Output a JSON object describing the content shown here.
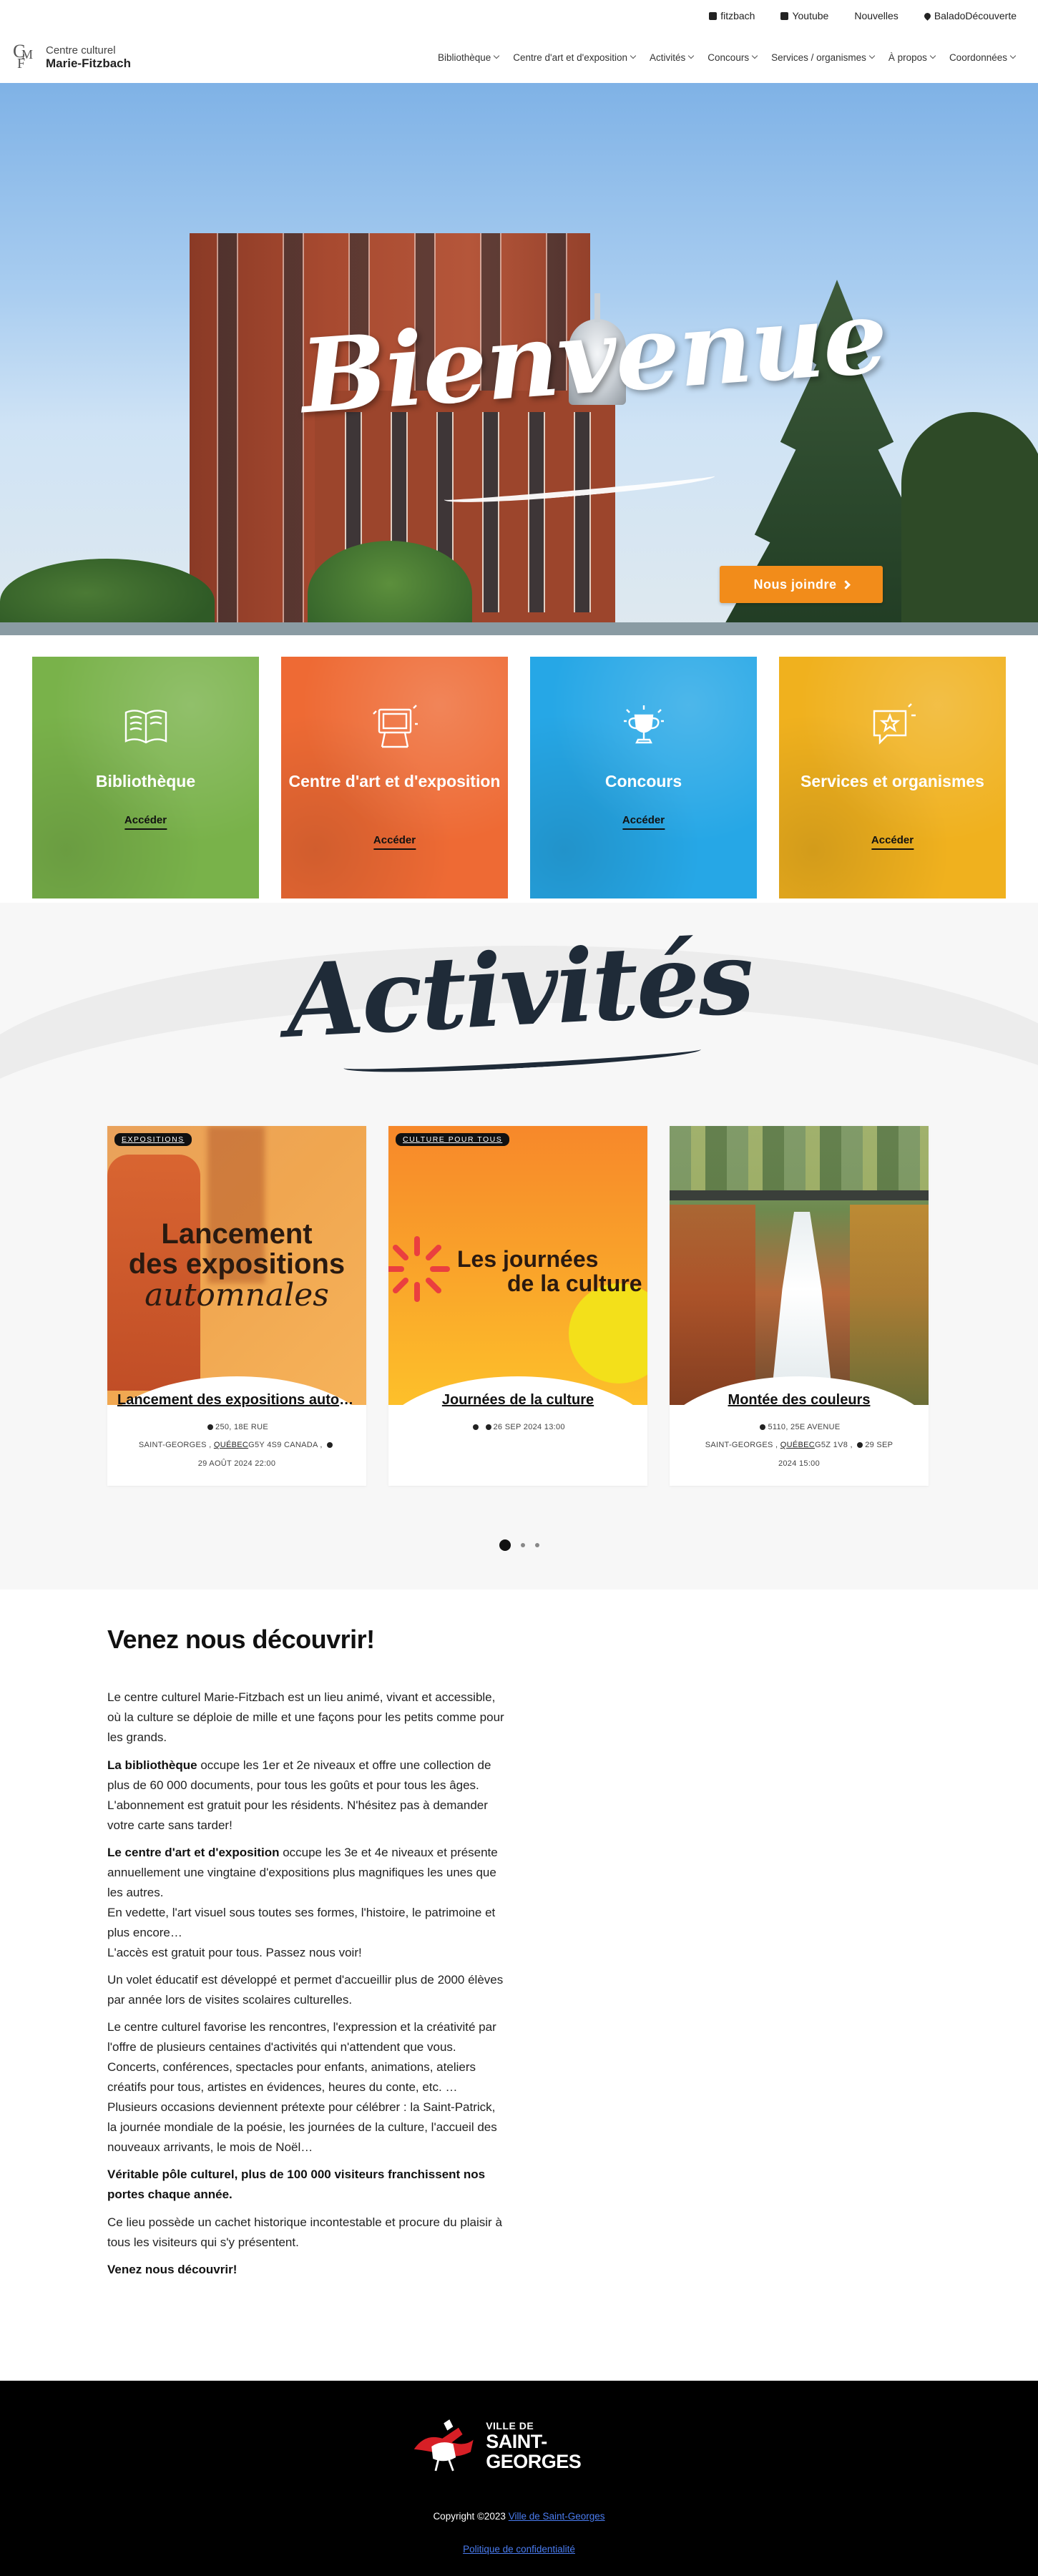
{
  "topbar": {
    "links": [
      {
        "label": "fitzbach",
        "icon": "facebook-icon"
      },
      {
        "label": "Youtube",
        "icon": "youtube-icon"
      },
      {
        "label": "Nouvelles"
      },
      {
        "label": "BaladoDécouverte",
        "icon": "map-pin-icon"
      }
    ]
  },
  "logo": {
    "line1": "Centre culturel",
    "line2": "Marie-Fitzbach",
    "mark": "CMF"
  },
  "nav": {
    "items": [
      {
        "label": "Bibliothèque"
      },
      {
        "label": "Centre d'art et d'exposition"
      },
      {
        "label": "Activités"
      },
      {
        "label": "Concours"
      },
      {
        "label": "Services / organismes"
      },
      {
        "label": "À propos"
      },
      {
        "label": "Coordonnées"
      }
    ]
  },
  "hero": {
    "title": "Bienvenue",
    "button": "Nous joindre"
  },
  "cards": [
    {
      "title": "Bibliothèque",
      "link": "Accéder",
      "color": "#79b24a",
      "icon": "open-book-icon"
    },
    {
      "title": "Centre d'art et d'exposition",
      "link": "Accéder",
      "color": "#ee6a34",
      "icon": "framed-art-icon"
    },
    {
      "title": "Concours",
      "link": "Accéder",
      "color": "#26a7e6",
      "icon": "trophy-icon"
    },
    {
      "title": "Services et organismes",
      "link": "Accéder",
      "color": "#f0b11e",
      "icon": "star-chat-icon"
    }
  ],
  "activities": {
    "title": "Activités",
    "items": [
      {
        "tag": "EXPOSITIONS",
        "image_text": [
          "Lancement",
          "des expositions",
          "automnales"
        ],
        "name": "Lancement des expositions automnales",
        "address": "250, 18E RUE",
        "city": "SAINT-GEORGES ,",
        "province": "QUÉBEC",
        "postal": "G5Y 4S9 CANADA ,",
        "datetime": "29 AOÛT 2024 22:00"
      },
      {
        "tag": "CULTURE POUR TOUS",
        "image_text": [
          "Les journées",
          "de la culture"
        ],
        "name": "Journées de la culture",
        "datetime": "26 SEP 2024 13:00"
      },
      {
        "name": "Montée des couleurs",
        "address": "5110, 25E AVENUE",
        "city": "SAINT-GEORGES ,",
        "province": "QUÉBEC",
        "postal": "G5Z 1V8 ,",
        "date": "29 SEP",
        "datetime2": "2024 15:00"
      }
    ],
    "pager": {
      "pages": 3,
      "active": 1
    }
  },
  "discover": {
    "title": "Venez nous découvrir!",
    "intro": "Le centre culturel Marie-Fitzbach est un lieu animé, vivant et accessible, où la culture se déploie de mille et une façons pour les petits comme pour les grands.",
    "library_bold": "La bibliothèque",
    "library_text": " occupe les 1er et 2e niveaux et offre une collection de plus de 60 000 documents, pour tous les goûts et pour tous les âges.",
    "library_text2": "L'abonnement est gratuit pour les résidents. N'hésitez pas à demander votre carte sans tarder!",
    "art_bold": "Le centre d'art et d'exposition",
    "art_text": " occupe les 3e et 4e niveaux et présente annuellement une vingtaine d'expositions plus magnifiques les unes que les autres.",
    "art_text2": "En vedette, l'art visuel sous toutes ses formes, l'histoire, le patrimoine et plus encore…",
    "art_text3": "L'accès est gratuit pour tous. Passez nous voir!",
    "education": "Un volet éducatif est développé et permet d'accueillir plus de 2000 élèves par année lors de visites scolaires culturelles.",
    "community": "Le centre culturel favorise les rencontres, l'expression et la créativité par l'offre de plusieurs centaines d'activités qui n'attendent que vous.",
    "community2": "Concerts, conférences, spectacles pour enfants, animations, ateliers créatifs pour tous, artistes en évidences, heures du conte, etc. …",
    "community3": "Plusieurs occasions deviennent prétexte pour célébrer : la Saint-Patrick, la journée mondiale de la poésie, les journées de la culture, l'accueil des nouveaux arrivants, le mois de Noël…",
    "pole": "Véritable pôle culturel, plus de 100 000 visiteurs franchissent nos portes chaque année.",
    "historic": "Ce lieu possède un cachet historique incontestable et procure du plaisir à tous les visiteurs qui s'y présentent.",
    "closing": "Venez nous découvrir!"
  },
  "footer": {
    "logo_small": "VILLE DE",
    "logo_big": "SAINT-GEORGES",
    "copyright": "Copyright ©2023 ",
    "copyright_link": "Ville de Saint-Georges",
    "privacy": "Politique de confidentialité"
  }
}
